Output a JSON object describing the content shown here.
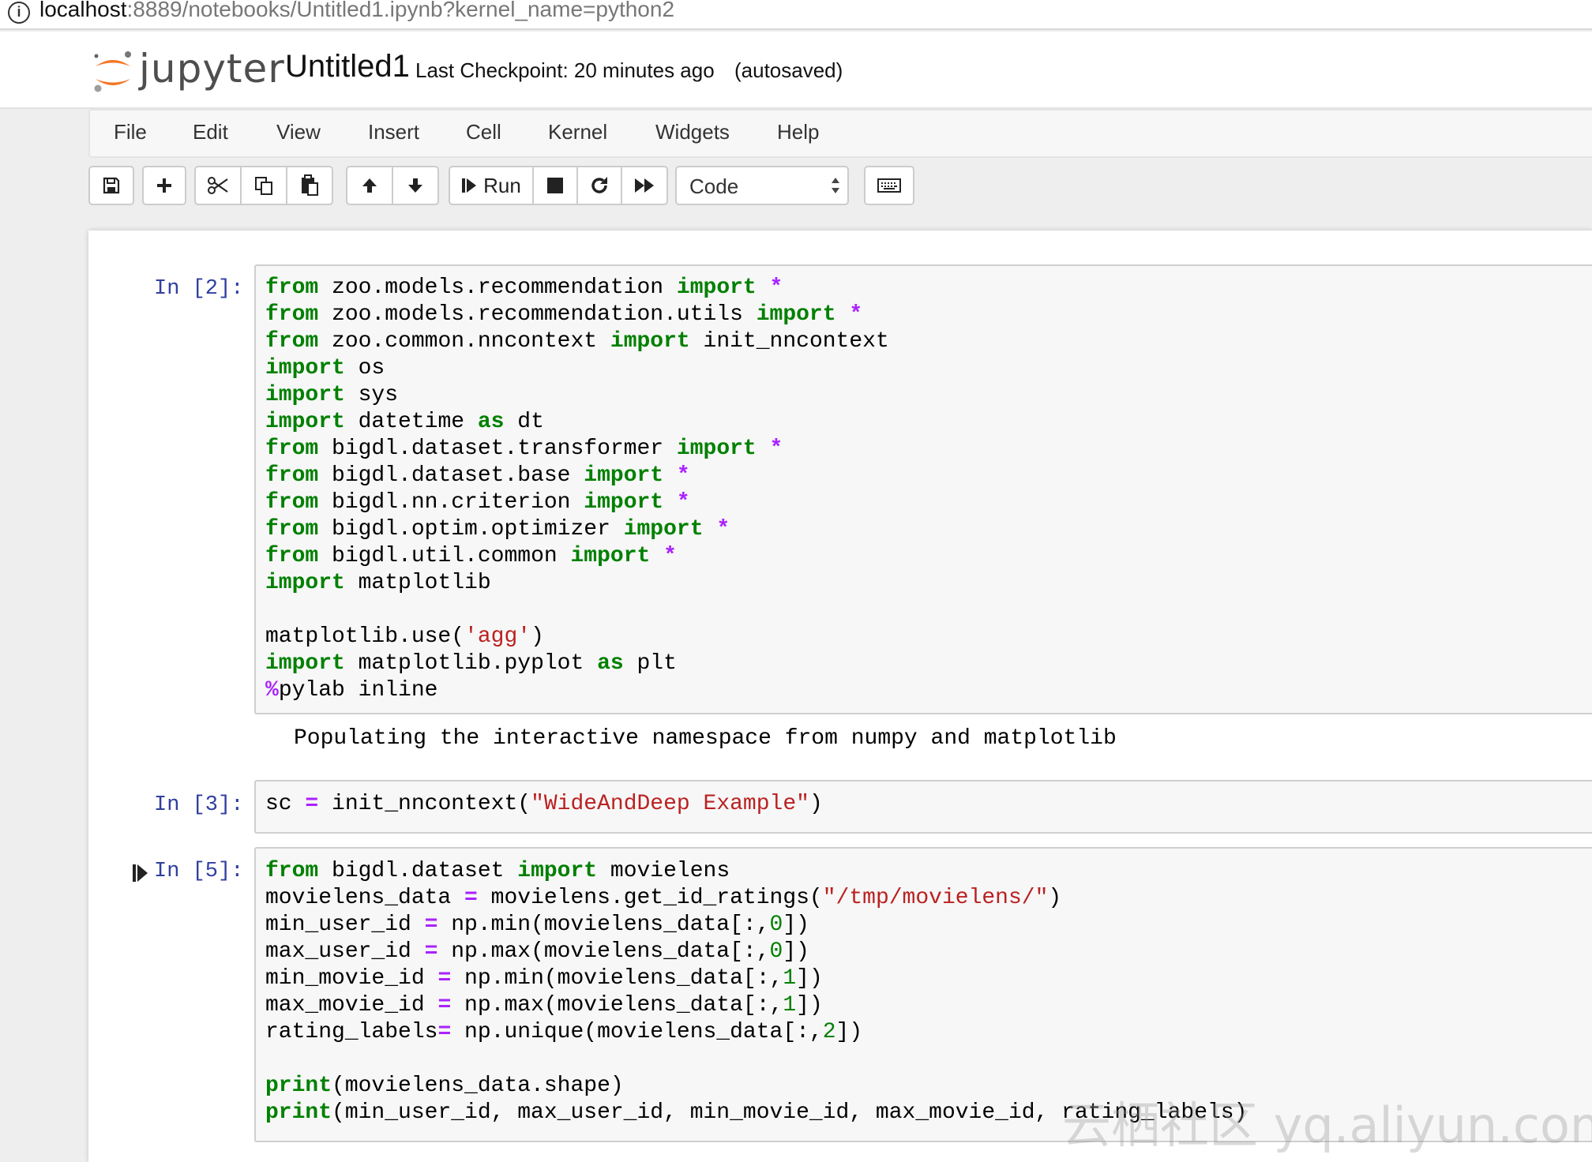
{
  "browser": {
    "url_host": "localhost",
    "url_path": ":8889/notebooks/Untitled1.ipynb?kernel_name=python2"
  },
  "header": {
    "logo_text": "jupyter",
    "notebook_title": "Untitled1",
    "checkpoint": "Last Checkpoint: 20 minutes ago",
    "autosave": "(autosaved)"
  },
  "menu": [
    "File",
    "Edit",
    "View",
    "Insert",
    "Cell",
    "Kernel",
    "Widgets",
    "Help"
  ],
  "toolbar": {
    "run_label": "Run",
    "cell_type": "Code",
    "icons": [
      "save-icon",
      "plus-icon",
      "scissors-icon",
      "copy-icon",
      "paste-icon",
      "arrow-up-icon",
      "arrow-down-icon",
      "step-forward-icon",
      "stop-icon",
      "refresh-icon",
      "fast-forward-icon",
      "keyboard-icon"
    ]
  },
  "cells": [
    {
      "prompt": "In [2]:",
      "lines": [
        "from zoo.models.recommendation import *",
        "from zoo.models.recommendation.utils import *",
        "from zoo.common.nncontext import init_nncontext",
        "import os",
        "import sys",
        "import datetime as dt",
        "from bigdl.dataset.transformer import *",
        "from bigdl.dataset.base import *",
        "from bigdl.nn.criterion import *",
        "from bigdl.optim.optimizer import *",
        "from bigdl.util.common import *",
        "import matplotlib",
        "",
        "matplotlib.use('agg')",
        "import matplotlib.pyplot as plt",
        "%pylab inline"
      ],
      "output": "Populating the interactive namespace from numpy and matplotlib"
    },
    {
      "prompt": "In [3]:",
      "lines": [
        "sc = init_nncontext(\"WideAndDeep Example\")"
      ]
    },
    {
      "prompt": "In [5]:",
      "lines": [
        "from bigdl.dataset import movielens",
        "movielens_data = movielens.get_id_ratings(\"/tmp/movielens/\")",
        "min_user_id = np.min(movielens_data[:,0])",
        "max_user_id = np.max(movielens_data[:,0])",
        "min_movie_id = np.min(movielens_data[:,1])",
        "max_movie_id = np.max(movielens_data[:,1])",
        "rating_labels= np.unique(movielens_data[:,2])",
        "",
        "print(movielens_data.shape)",
        "print(min_user_id, max_user_id, min_movie_id, max_movie_id, rating_labels)"
      ]
    }
  ],
  "watermark": "云栖社区 yq.aliyun.com",
  "colors": {
    "keyword": "#008000",
    "operator": "#aa22ff",
    "string": "#ba2121",
    "prompt": "#303f9f",
    "cell_bg": "#f7f7f7"
  }
}
